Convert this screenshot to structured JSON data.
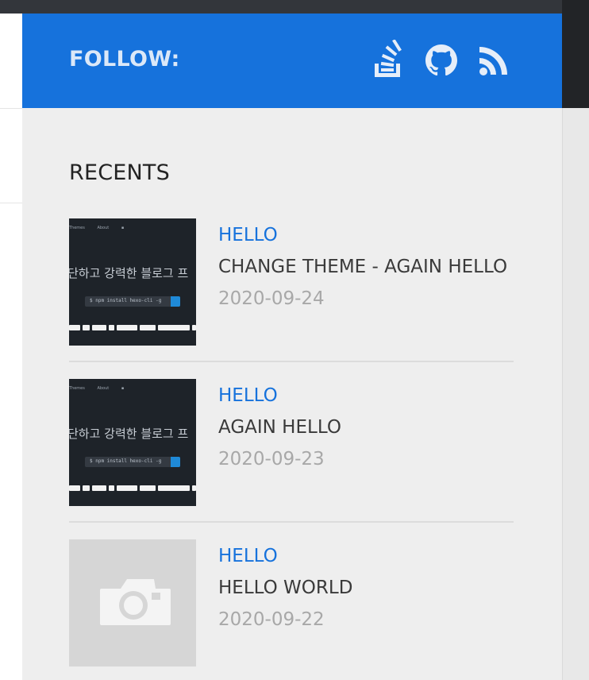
{
  "follow": {
    "label": "FOLLOW:",
    "icons": [
      "stackoverflow-icon",
      "github-icon",
      "rss-icon"
    ]
  },
  "recents": {
    "title": "RECENTS",
    "posts": [
      {
        "category": "HELLO",
        "title": "CHANGE THEME - AGAIN HELLO",
        "date": "2020-09-24",
        "thumb": {
          "nav": [
            "Themes",
            "About"
          ],
          "tagline": "단하고 강력한 블로그 프",
          "command": "$ npm install hexo-cli -g"
        }
      },
      {
        "category": "HELLO",
        "title": "AGAIN HELLO",
        "date": "2020-09-23",
        "thumb": {
          "nav": [
            "Themes",
            "About"
          ],
          "tagline": "단하고 강력한 블로그 프",
          "command": "$ npm install hexo-cli -g"
        }
      },
      {
        "category": "HELLO",
        "title": "HELLO WORLD",
        "date": "2020-09-22",
        "thumb": {
          "placeholder": "camera-icon"
        }
      }
    ]
  },
  "colors": {
    "accent": "#1672dc",
    "sidebar_bg": "#eeeeee",
    "date_text": "#a8a8a8"
  }
}
